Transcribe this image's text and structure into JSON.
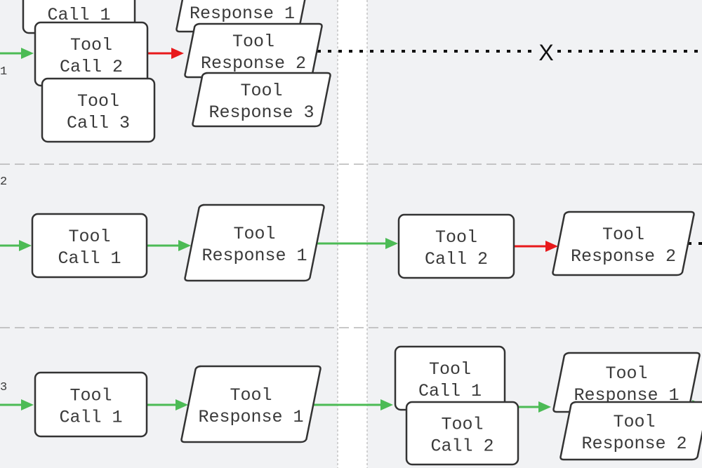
{
  "colors": {
    "background": "#f1f2f4",
    "success_arrow": "#4cbb55",
    "error_arrow": "#e8191b",
    "node_stroke": "#333333",
    "node_fill": "#ffffff",
    "separator": "#b5b5b5"
  },
  "row_labels": [
    "1",
    "2",
    "3"
  ],
  "failure_marker": "X",
  "rows": [
    {
      "label": "1",
      "nodes": [
        {
          "type": "call",
          "lines": [
            "Call 1"
          ]
        },
        {
          "type": "call",
          "lines": [
            "Tool",
            "Call 2"
          ]
        },
        {
          "type": "call",
          "lines": [
            "Tool",
            "Call 3"
          ]
        },
        {
          "type": "response",
          "lines": [
            "Response 1"
          ]
        },
        {
          "type": "response",
          "lines": [
            "Tool",
            "Response 2"
          ]
        },
        {
          "type": "response",
          "lines": [
            "Tool",
            "Response 3"
          ]
        }
      ]
    },
    {
      "label": "2",
      "nodes": [
        {
          "type": "call",
          "lines": [
            "Tool",
            "Call 1"
          ]
        },
        {
          "type": "response",
          "lines": [
            "Tool",
            "Response 1"
          ]
        },
        {
          "type": "call",
          "lines": [
            "Tool",
            "Call 2"
          ]
        },
        {
          "type": "response",
          "lines": [
            "Tool",
            "Response 2"
          ]
        }
      ]
    },
    {
      "label": "3",
      "nodes": [
        {
          "type": "call",
          "lines": [
            "Tool",
            "Call 1"
          ]
        },
        {
          "type": "response",
          "lines": [
            "Tool",
            "Response 1"
          ]
        },
        {
          "type": "call",
          "lines": [
            "Tool",
            "Call 1"
          ]
        },
        {
          "type": "call",
          "lines": [
            "Tool",
            "Call 2"
          ]
        },
        {
          "type": "response",
          "lines": [
            "Tool",
            "Response 1"
          ]
        },
        {
          "type": "response",
          "lines": [
            "Tool",
            "Response 2"
          ]
        }
      ]
    }
  ]
}
